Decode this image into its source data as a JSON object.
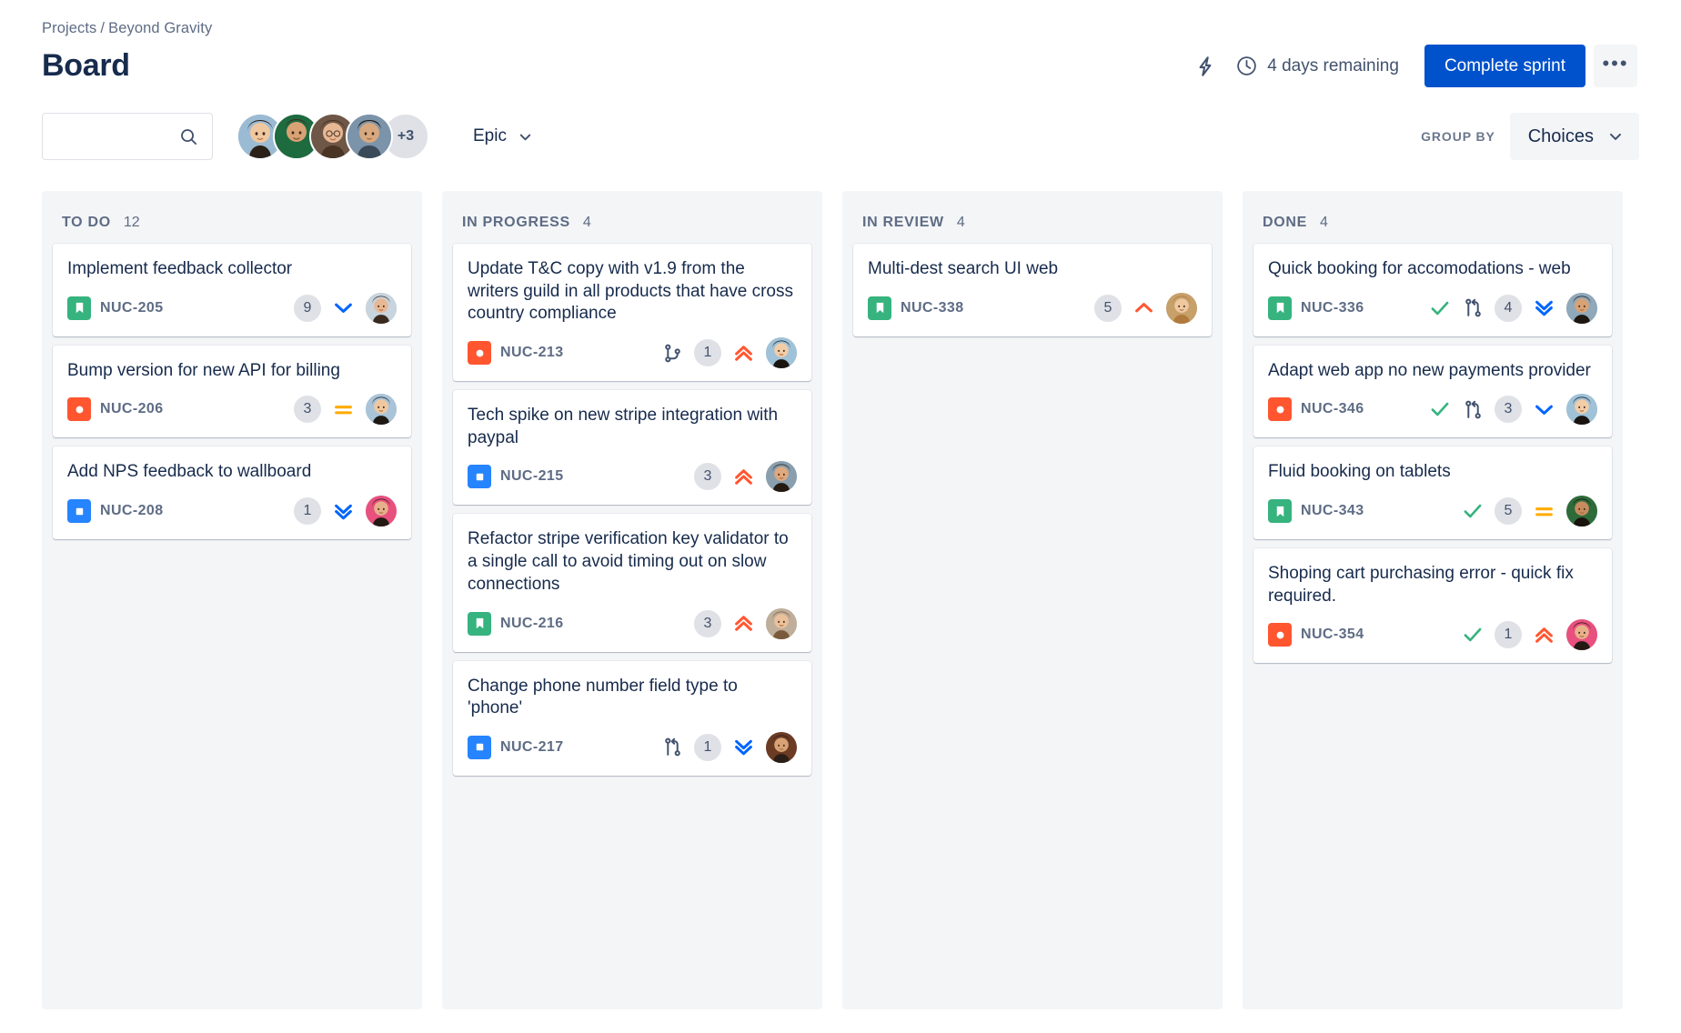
{
  "breadcrumb": {
    "root": "Projects",
    "separator": "/",
    "project": "Beyond Gravity"
  },
  "header": {
    "title": "Board",
    "insight_icon": "lightning-icon",
    "clock_icon": "clock-icon",
    "sprint_remaining": "4 days remaining",
    "complete_sprint_label": "Complete sprint",
    "more_label": "•••",
    "primary_color": "#0052CC"
  },
  "toolbar": {
    "search_placeholder": "",
    "search_value": "",
    "search_icon": "search-icon",
    "avatar_overflow": "+3",
    "avatars": [
      {
        "name": "avatar-1",
        "skin": "#F0C8A0",
        "hair": "#2B2118",
        "bg": "#9BBBD4"
      },
      {
        "name": "avatar-2",
        "skin": "#D9A274",
        "hair": "#3A3028",
        "bg": "#1D6B3F"
      },
      {
        "name": "avatar-3",
        "skin": "#E8B894",
        "hair": "#4A3524",
        "bg": "#6E5747"
      },
      {
        "name": "avatar-4",
        "skin": "#D8A87F",
        "hair": "#221A14",
        "bg": "#7C94AA"
      }
    ],
    "epic_label": "Epic",
    "epic_chevron": "chevron-down-icon",
    "group_by_label": "GROUP BY",
    "group_by_value": "Choices",
    "group_by_chevron": "chevron-down-icon"
  },
  "columns": [
    {
      "id": "todo",
      "name": "TO DO",
      "count": "12",
      "cards": [
        {
          "title": "Implement feedback collector",
          "key": "NUC-205",
          "type": "story",
          "dev": null,
          "count": "9",
          "priority": "low",
          "avatar": {
            "skin": "#E8B894",
            "hair": "#3A2A1E",
            "bg": "#C8D4DE"
          }
        },
        {
          "title": "Bump version for new API for billing",
          "key": "NUC-206",
          "type": "bug",
          "dev": null,
          "count": "3",
          "priority": "medium",
          "avatar": {
            "skin": "#F0C8A0",
            "hair": "#1E1813",
            "bg": "#A9C4D8"
          }
        },
        {
          "title": "Add NPS feedback to wallboard",
          "key": "NUC-208",
          "type": "task",
          "dev": null,
          "count": "1",
          "priority": "lowest",
          "avatar": {
            "skin": "#E8B08A",
            "hair": "#241A14",
            "bg": "#E8507E"
          }
        }
      ]
    },
    {
      "id": "inprogress",
      "name": "IN PROGRESS",
      "count": "4",
      "cards": [
        {
          "title": "Update T&C copy with v1.9 from the writers guild in all products that have cross country compliance",
          "key": "NUC-213",
          "type": "bug",
          "dev": "branch-icon",
          "count": "1",
          "priority": "highest",
          "avatar": {
            "skin": "#F2CDA8",
            "hair": "#1A1410",
            "bg": "#9FC2D8"
          }
        },
        {
          "title": "Tech spike on new stripe integration with paypal",
          "key": "NUC-215",
          "type": "task",
          "dev": null,
          "count": "3",
          "priority": "highest",
          "avatar": {
            "skin": "#E0A87E",
            "hair": "#241A12",
            "bg": "#8A9FAE"
          }
        },
        {
          "title": "Refactor stripe verification key validator to a single call to avoid timing out on slow connections",
          "key": "NUC-216",
          "type": "story",
          "dev": null,
          "count": "3",
          "priority": "highest",
          "avatar": {
            "skin": "#EBC19B",
            "hair": "#7A5A3C",
            "bg": "#BFAE99"
          }
        },
        {
          "title": "Change phone number field type to 'phone'",
          "key": "NUC-217",
          "type": "task",
          "dev": "pull-request-icon",
          "count": "1",
          "priority": "lowest",
          "avatar": {
            "skin": "#D9A274",
            "hair": "#2A1E16",
            "bg": "#6B3B24"
          }
        }
      ]
    },
    {
      "id": "inreview",
      "name": "IN REVIEW",
      "count": "4",
      "cards": [
        {
          "title": "Multi-dest search UI web",
          "key": "NUC-338",
          "type": "story",
          "dev": null,
          "count": "5",
          "priority": "high",
          "avatar": {
            "skin": "#F0C8A0",
            "hair": "#B07A3C",
            "bg": "#C7A06A"
          }
        }
      ]
    },
    {
      "id": "done",
      "name": "DONE",
      "count": "4",
      "cards": [
        {
          "title": "Quick booking for accomodations - web",
          "key": "NUC-336",
          "type": "story",
          "done": true,
          "dev": "pull-request-icon",
          "count": "4",
          "priority": "lowest",
          "avatar": {
            "skin": "#D9A274",
            "hair": "#1E1610",
            "bg": "#8FA8BA"
          }
        },
        {
          "title": "Adapt web app no new payments provider",
          "key": "NUC-346",
          "type": "bug",
          "done": true,
          "dev": "pull-request-icon",
          "count": "3",
          "priority": "low",
          "avatar": {
            "skin": "#F2CDA8",
            "hair": "#1A1410",
            "bg": "#9FC2D8"
          }
        },
        {
          "title": "Fluid booking on tablets",
          "key": "NUC-343",
          "type": "story",
          "done": true,
          "dev": null,
          "count": "5",
          "priority": "medium",
          "avatar": {
            "skin": "#C98B5E",
            "hair": "#1A120C",
            "bg": "#2E6B3A"
          }
        },
        {
          "title": "Shoping cart purchasing error - quick fix required.",
          "key": "NUC-354",
          "type": "bug",
          "done": true,
          "dev": null,
          "count": "1",
          "priority": "highest",
          "avatar": {
            "skin": "#E8B08A",
            "hair": "#241A14",
            "bg": "#E8507E"
          }
        }
      ]
    }
  ],
  "icon_colors": {
    "story": "#36B37E",
    "bug": "#FF5630",
    "task": "#2684FF",
    "priority_highest": "#FF5630",
    "priority_high": "#FF5630",
    "priority_medium": "#FFAB00",
    "priority_low": "#0065FF",
    "priority_lowest": "#0065FF",
    "done_check": "#36B37E"
  }
}
